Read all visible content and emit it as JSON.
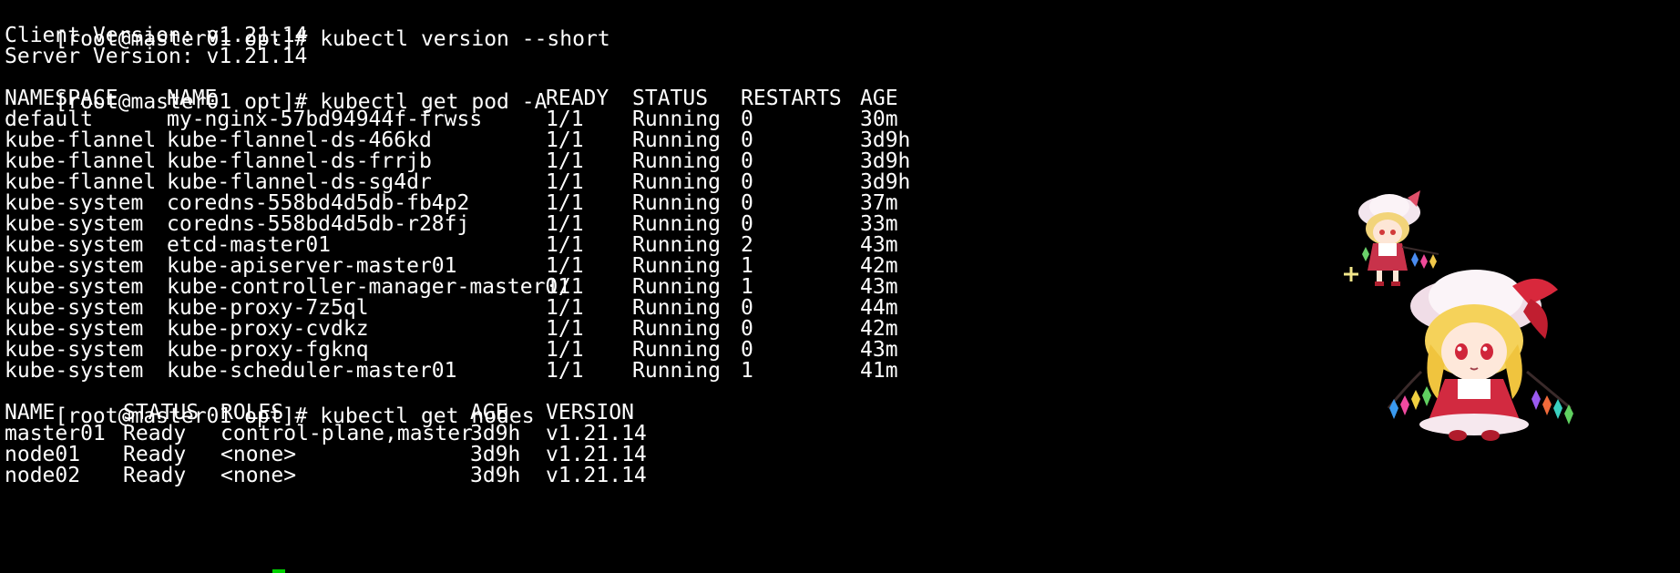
{
  "prompt": "[root@master01 opt]# ",
  "commands": {
    "version": "kubectl version --short",
    "get_pods": "kubectl get pod -A",
    "get_nodes": "kubectl get nodes"
  },
  "version_output": {
    "client": "Client Version: v1.21.14",
    "server": "Server Version: v1.21.14"
  },
  "pods": {
    "headers": [
      "NAMESPACE",
      "NAME",
      "READY",
      "STATUS",
      "RESTARTS",
      "AGE"
    ],
    "rows": [
      [
        "default",
        "my-nginx-57bd94944f-frwss",
        "1/1",
        "Running",
        "0",
        "30m"
      ],
      [
        "kube-flannel",
        "kube-flannel-ds-466kd",
        "1/1",
        "Running",
        "0",
        "3d9h"
      ],
      [
        "kube-flannel",
        "kube-flannel-ds-frrjb",
        "1/1",
        "Running",
        "0",
        "3d9h"
      ],
      [
        "kube-flannel",
        "kube-flannel-ds-sg4dr",
        "1/1",
        "Running",
        "0",
        "3d9h"
      ],
      [
        "kube-system",
        "coredns-558bd4d5db-fb4p2",
        "1/1",
        "Running",
        "0",
        "37m"
      ],
      [
        "kube-system",
        "coredns-558bd4d5db-r28fj",
        "1/1",
        "Running",
        "0",
        "33m"
      ],
      [
        "kube-system",
        "etcd-master01",
        "1/1",
        "Running",
        "2",
        "43m"
      ],
      [
        "kube-system",
        "kube-apiserver-master01",
        "1/1",
        "Running",
        "1",
        "42m"
      ],
      [
        "kube-system",
        "kube-controller-manager-master01",
        "1/1",
        "Running",
        "1",
        "43m"
      ],
      [
        "kube-system",
        "kube-proxy-7z5ql",
        "1/1",
        "Running",
        "0",
        "44m"
      ],
      [
        "kube-system",
        "kube-proxy-cvdkz",
        "1/1",
        "Running",
        "0",
        "42m"
      ],
      [
        "kube-system",
        "kube-proxy-fgknq",
        "1/1",
        "Running",
        "0",
        "43m"
      ],
      [
        "kube-system",
        "kube-scheduler-master01",
        "1/1",
        "Running",
        "1",
        "41m"
      ]
    ]
  },
  "nodes": {
    "headers": [
      "NAME",
      "STATUS",
      "ROLES",
      "AGE",
      "VERSION"
    ],
    "rows": [
      [
        "master01",
        "Ready",
        "control-plane,master",
        "3d9h",
        "v1.21.14"
      ],
      [
        "node01",
        "Ready",
        "<none>",
        "3d9h",
        "v1.21.14"
      ],
      [
        "node02",
        "Ready",
        "<none>",
        "3d9h",
        "v1.21.14"
      ]
    ]
  },
  "colors": {
    "background": "#000000",
    "text": "#ffffff",
    "cursor": "#00d000"
  },
  "decorations": [
    "small-mascot-sprite",
    "large-mascot-sprite"
  ]
}
